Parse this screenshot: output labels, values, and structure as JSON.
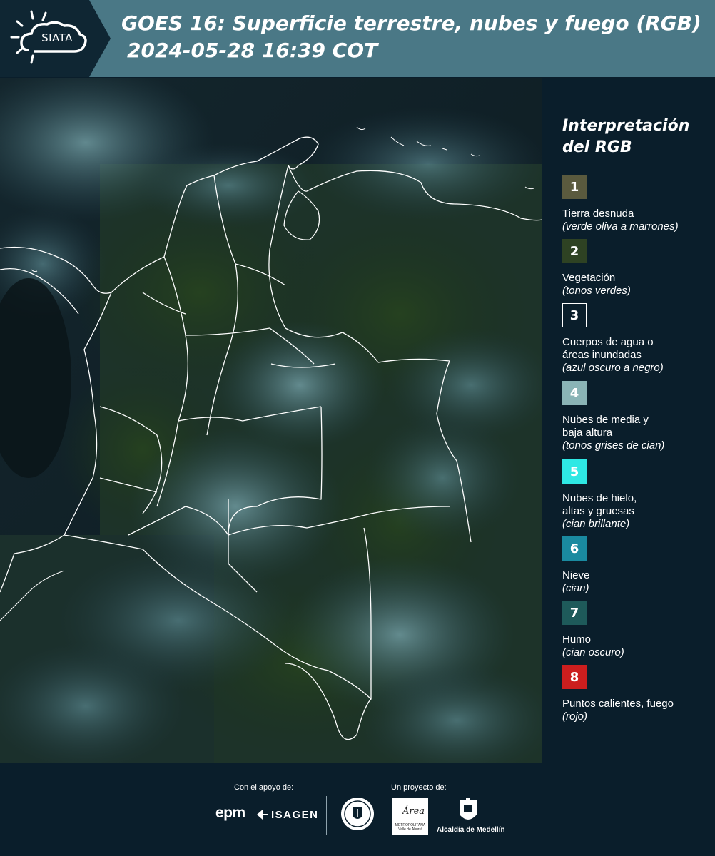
{
  "header": {
    "logo_text": "SIATA",
    "title_line1": "GOES 16: Superficie terrestre, nubes y fuego (RGB)",
    "title_line2": "2024-05-28 16:39 COT"
  },
  "legend": {
    "title": "Interpretación del RGB",
    "items": [
      {
        "number": "1",
        "name": "Tierra desnuda",
        "hint": "(verde oliva a marrones)",
        "color": "#5a5a3e"
      },
      {
        "number": "2",
        "name": "Vegetación",
        "hint": "(tonos verdes)",
        "color": "#2e4223"
      },
      {
        "number": "3",
        "name": "Cuerpos de agua o\náreas inundadas",
        "hint": "(azul oscuro a negro)",
        "color": "#0a1e2b"
      },
      {
        "number": "4",
        "name": "Nubes de media y\nbaja altura",
        "hint": "(tonos grises de cian)",
        "color": "#8ab4b6"
      },
      {
        "number": "5",
        "name": "Nubes de hielo,\naltas y gruesas",
        "hint": "(cian brillante)",
        "color": "#2ee8e4"
      },
      {
        "number": "6",
        "name": "Nieve",
        "hint": "(cian)",
        "color": "#1a8aa0"
      },
      {
        "number": "7",
        "name": "Humo",
        "hint": "(cian oscuro)",
        "color": "#1e5a5a"
      },
      {
        "number": "8",
        "name": "Puntos calientes, fuego",
        "hint": "(rojo)",
        "color": "#cc1e1e"
      }
    ]
  },
  "footer": {
    "support_label": "Con el apoyo de:",
    "project_label": "Un proyecto de:",
    "epm": "epm",
    "isagen": "ISAGEN",
    "area_word": "Área",
    "area_sub": "METROPOLITANA Valle de Aburrá",
    "alcaldia": "Alcaldía de Medellín"
  }
}
